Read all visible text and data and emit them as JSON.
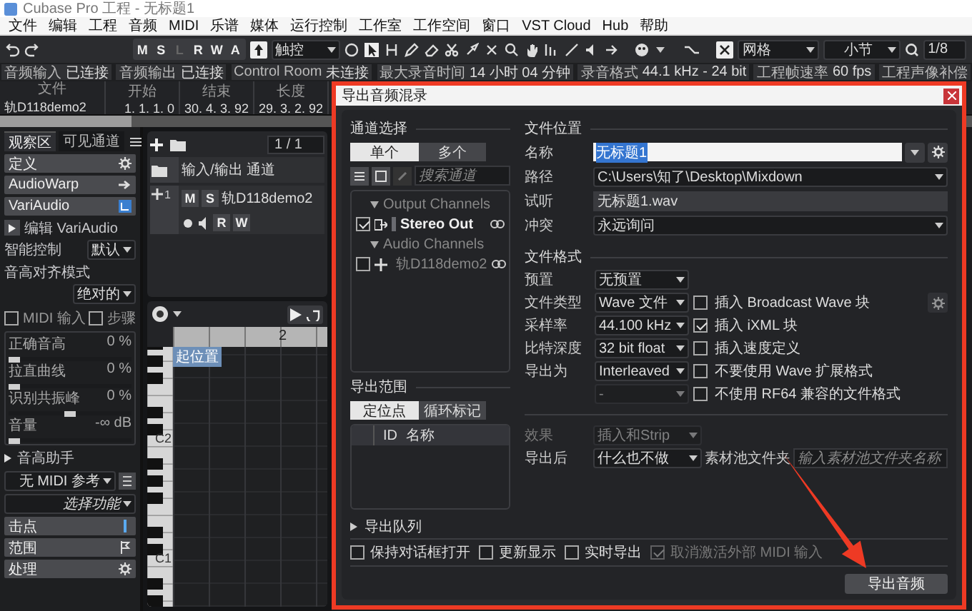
{
  "window": {
    "title": "Cubase Pro 工程 - 无标题1"
  },
  "menu": [
    "文件",
    "编辑",
    "工程",
    "音频",
    "MIDI",
    "乐谱",
    "媒体",
    "运行控制",
    "工作室",
    "工作空间",
    "窗口",
    "VST Cloud",
    "Hub",
    "帮助"
  ],
  "toolbar": {
    "buttons": [
      {
        "label": "M",
        "disabled": false
      },
      {
        "label": "S",
        "disabled": false
      },
      {
        "label": "L",
        "disabled": true
      },
      {
        "label": "R",
        "disabled": false
      },
      {
        "label": "W",
        "disabled": false
      },
      {
        "label": "A",
        "disabled": false
      }
    ],
    "mode": "触控",
    "snap": "网格",
    "grid": "小节",
    "quantize": "1/8"
  },
  "status_bar": [
    {
      "label": "音频输入",
      "value": "已连接"
    },
    {
      "label": "音频输出",
      "value": "已连接"
    },
    {
      "label": "Control Room",
      "value": "未连接"
    },
    {
      "label": "最大录音时间",
      "value": "14 小时 04 分钟"
    },
    {
      "label": "录音格式",
      "value": "44.1 kHz - 24 bit"
    },
    {
      "label": "工程帧速率",
      "value": "60 fps"
    },
    {
      "label": "工程声像补偿"
    }
  ],
  "transport": [
    {
      "label": "文件",
      "value": "轨D118demo2"
    },
    {
      "label": "开始",
      "value": "1. 1. 1. 0"
    },
    {
      "label": "结束",
      "value": "30. 4. 3. 92"
    },
    {
      "label": "长度",
      "value": "29. 3. 2. 92"
    }
  ],
  "inspector": {
    "tabs": [
      {
        "label": "观察区",
        "selected": true
      },
      {
        "label": "可见通道",
        "selected": false
      }
    ],
    "items": [
      {
        "kind": "section",
        "label": "定义"
      },
      {
        "kind": "section",
        "label": "AudioWarp"
      },
      {
        "kind": "section",
        "label": "VariAudio"
      },
      {
        "kind": "action",
        "label": "编辑 VariAudio"
      },
      {
        "kind": "select",
        "label": "智能控制",
        "value": "默认"
      },
      {
        "kind": "select",
        "label": "音高对齐模式",
        "value": "绝对的"
      },
      {
        "kind": "checks",
        "items": [
          {
            "label": "MIDI 输入",
            "checked": false
          },
          {
            "label": "步骤",
            "checked": false
          }
        ]
      },
      {
        "kind": "slider",
        "label": "正确音高",
        "reading": "0 %",
        "level": 0
      },
      {
        "kind": "slider",
        "label": "拉直曲线",
        "reading": "0 %",
        "level": 0
      },
      {
        "kind": "slider",
        "label": "识别共振峰",
        "reading": "0 %",
        "level": 0.5
      },
      {
        "kind": "slider",
        "label": "音量",
        "reading": "-∞ dB",
        "level": 0
      },
      {
        "kind": "expander",
        "label": "音高助手",
        "expanded": false
      },
      {
        "kind": "wide",
        "value": "无 MIDI 参考"
      },
      {
        "kind": "menu",
        "value": "选择功能"
      },
      {
        "kind": "section",
        "label": "击点"
      },
      {
        "kind": "section",
        "label": "范围"
      },
      {
        "kind": "section",
        "label": "处理"
      }
    ]
  },
  "project": {
    "counter": "1 / 1",
    "folder": "输入/输出 通道",
    "track": {
      "number": "1",
      "name": "轨D118demo2",
      "buttons": [
        "M",
        "S",
        "R",
        "W"
      ]
    },
    "ruler": "2",
    "cursor_label": "起位置",
    "keys": [
      "C2",
      "C1"
    ]
  },
  "export_dialog": {
    "title": "导出音频混录",
    "channel_selection": {
      "heading": "通道选择",
      "modes": [
        {
          "label": "单个",
          "selected": true
        },
        {
          "label": "多个",
          "selected": false
        }
      ],
      "search": {
        "placeholder": "搜索通道"
      },
      "tree": [
        {
          "label": "Output Channels",
          "expanded": true,
          "children": [
            {
              "label": "Stereo Out",
              "checked": true
            }
          ]
        },
        {
          "label": "Audio Channels",
          "expanded": true,
          "children": [
            {
              "label": "轨D118demo2",
              "checked": false
            }
          ]
        }
      ]
    },
    "export_range": {
      "heading": "导出范围",
      "modes": [
        {
          "label": "定位点",
          "selected": true
        },
        {
          "label": "循环标记",
          "selected": false
        }
      ],
      "columns": [
        "ID",
        "名称"
      ]
    },
    "file_location": {
      "heading": "文件位置",
      "rows": [
        {
          "kind": "name",
          "label": "名称",
          "value": "无标题1"
        },
        {
          "kind": "dropdown",
          "label": "路径",
          "value": "C:\\Users\\知了\\Desktop\\Mixdown"
        },
        {
          "kind": "display",
          "label": "试听",
          "value": "无标题1.wav"
        },
        {
          "kind": "dropdown",
          "label": "冲突",
          "value": "永远询问"
        }
      ]
    },
    "file_format": {
      "heading": "文件格式",
      "fields": [
        {
          "label": "预置",
          "value": "无预置",
          "disabled": false
        },
        {
          "label": "文件类型",
          "value": "Wave 文件",
          "disabled": false
        },
        {
          "label": "采样率",
          "value": "44.100 kHz",
          "disabled": false
        },
        {
          "label": "比特深度",
          "value": "32 bit float",
          "disabled": false
        },
        {
          "label": "导出为",
          "value": "Interleaved",
          "disabled": false
        },
        {
          "value": "-",
          "disabled": true
        }
      ],
      "options": [
        {
          "label": "插入 Broadcast Wave 块",
          "checked": false
        },
        {
          "label": "插入 iXML 块",
          "checked": true
        },
        {
          "label": "插入速度定义",
          "checked": false
        },
        {
          "label": "不要使用 Wave 扩展格式",
          "checked": false
        },
        {
          "label": "不使用 RF64 兼容的文件格式",
          "checked": false
        }
      ]
    },
    "after": [
      {
        "label": "效果",
        "value": "插入和Strip",
        "disabled": true
      },
      {
        "label": "导出后",
        "value": "什么也不做",
        "disabled": false
      }
    ],
    "pool": {
      "label": "素材池文件夹",
      "placeholder": "输入素材池文件夹名称"
    },
    "queue": {
      "label": "导出队列",
      "expanded": false
    },
    "options": [
      {
        "label": "保持对话框打开",
        "checked": false,
        "disabled": false
      },
      {
        "label": "更新显示",
        "checked": false,
        "disabled": false
      },
      {
        "label": "实时导出",
        "checked": false,
        "disabled": false
      },
      {
        "label": "取消激活外部 MIDI 输入",
        "checked": true,
        "disabled": true
      }
    ],
    "export_button": "导出音频"
  }
}
